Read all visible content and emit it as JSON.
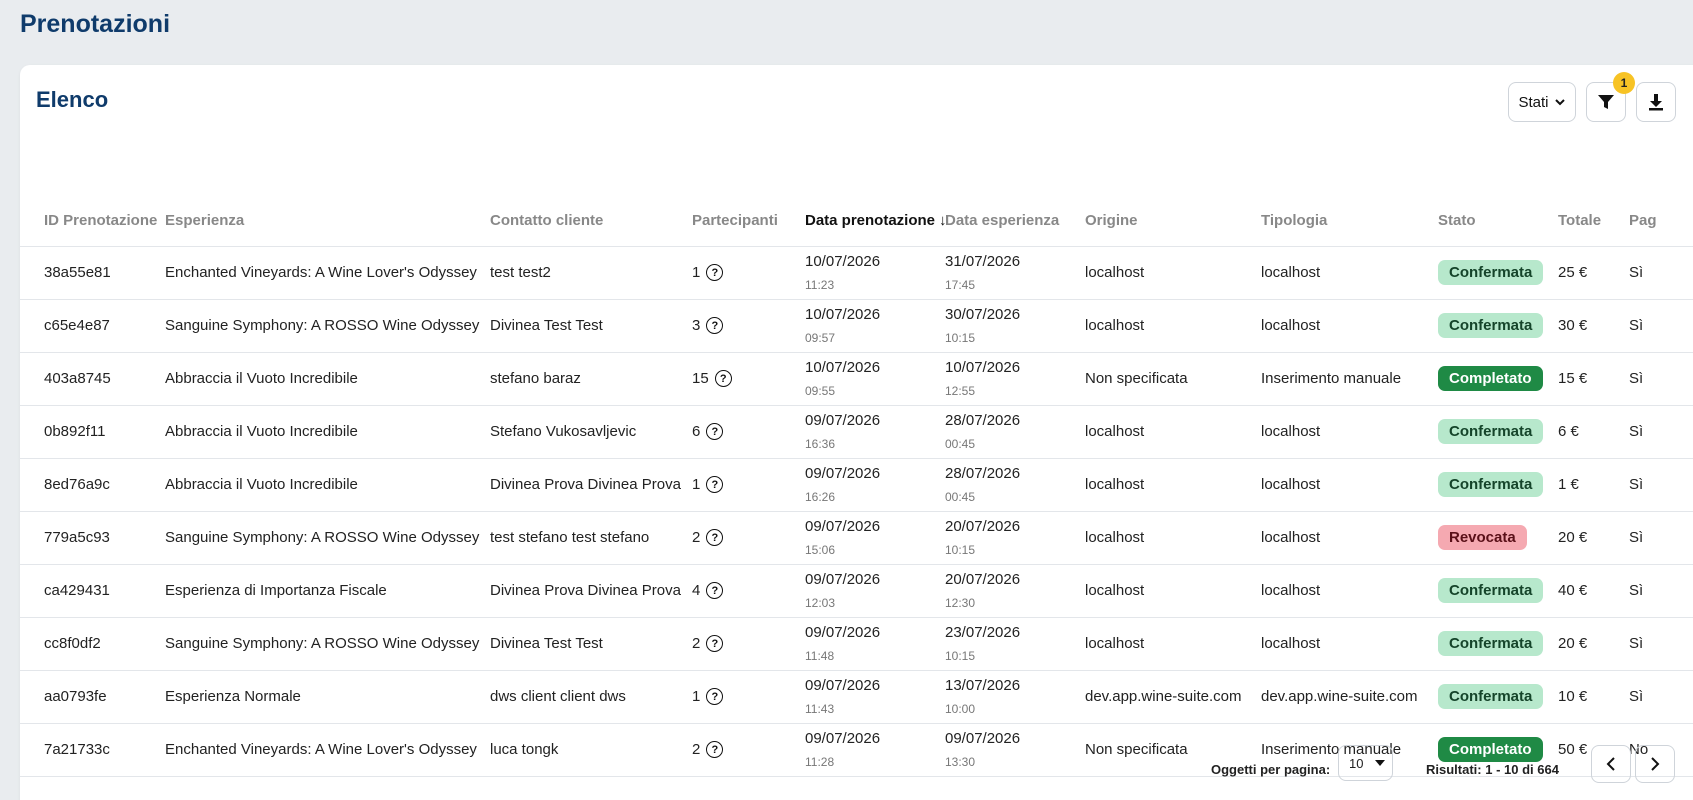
{
  "page_title": "Prenotazioni",
  "card_title": "Elenco",
  "toolbar": {
    "stati_label": "Stati",
    "filter_badge": "1"
  },
  "columns": [
    "ID Prenotazione",
    "Esperienza",
    "Contatto cliente",
    "Partecipanti",
    "Data prenotazione",
    "Data esperienza",
    "Origine",
    "Tipologia",
    "Stato",
    "Totale",
    "Pag"
  ],
  "sort_icon": "↓",
  "rows": [
    {
      "id": "38a55e81",
      "exp": "Enchanted Vineyards: A Wine Lover's Odyssey",
      "contact": "test test2",
      "part": "1",
      "bdate": "10/07/2026",
      "btime": "11:23",
      "edate": "31/07/2026",
      "etime": "17:45",
      "origin": "localhost",
      "type": "localhost",
      "status": "Confermata",
      "tot": "25 €",
      "pag": "Sì"
    },
    {
      "id": "c65e4e87",
      "exp": "Sanguine Symphony: A ROSSO Wine Odyssey",
      "contact": "Divinea Test Test",
      "part": "3",
      "bdate": "10/07/2026",
      "btime": "09:57",
      "edate": "30/07/2026",
      "etime": "10:15",
      "origin": "localhost",
      "type": "localhost",
      "status": "Confermata",
      "tot": "30 €",
      "pag": "Sì"
    },
    {
      "id": "403a8745",
      "exp": "Abbraccia il Vuoto Incredibile",
      "contact": "stefano baraz",
      "part": "15",
      "bdate": "10/07/2026",
      "btime": "09:55",
      "edate": "10/07/2026",
      "etime": "12:55",
      "origin": "Non specificata",
      "type": "Inserimento manuale",
      "status": "Completato",
      "tot": "15 €",
      "pag": "Sì"
    },
    {
      "id": "0b892f11",
      "exp": "Abbraccia il Vuoto Incredibile",
      "contact": "Stefano Vukosavljevic",
      "part": "6",
      "bdate": "09/07/2026",
      "btime": "16:36",
      "edate": "28/07/2026",
      "etime": "00:45",
      "origin": "localhost",
      "type": "localhost",
      "status": "Confermata",
      "tot": "6 €",
      "pag": "Sì"
    },
    {
      "id": "8ed76a9c",
      "exp": "Abbraccia il Vuoto Incredibile",
      "contact": "Divinea Prova Divinea Prova",
      "part": "1",
      "bdate": "09/07/2026",
      "btime": "16:26",
      "edate": "28/07/2026",
      "etime": "00:45",
      "origin": "localhost",
      "type": "localhost",
      "status": "Confermata",
      "tot": "1 €",
      "pag": "Sì"
    },
    {
      "id": "779a5c93",
      "exp": "Sanguine Symphony: A ROSSO Wine Odyssey",
      "contact": "test stefano test stefano",
      "part": "2",
      "bdate": "09/07/2026",
      "btime": "15:06",
      "edate": "20/07/2026",
      "etime": "10:15",
      "origin": "localhost",
      "type": "localhost",
      "status": "Revocata",
      "tot": "20 €",
      "pag": "Sì"
    },
    {
      "id": "ca429431",
      "exp": "Esperienza di Importanza Fiscale",
      "contact": "Divinea Prova Divinea Prova",
      "part": "4",
      "bdate": "09/07/2026",
      "btime": "12:03",
      "edate": "20/07/2026",
      "etime": "12:30",
      "origin": "localhost",
      "type": "localhost",
      "status": "Confermata",
      "tot": "40 €",
      "pag": "Sì"
    },
    {
      "id": "cc8f0df2",
      "exp": "Sanguine Symphony: A ROSSO Wine Odyssey",
      "contact": "Divinea Test Test",
      "part": "2",
      "bdate": "09/07/2026",
      "btime": "11:48",
      "edate": "23/07/2026",
      "etime": "10:15",
      "origin": "localhost",
      "type": "localhost",
      "status": "Confermata",
      "tot": "20 €",
      "pag": "Sì"
    },
    {
      "id": "aa0793fe",
      "exp": "Esperienza Normale",
      "contact": "dws client client dws",
      "part": "1",
      "bdate": "09/07/2026",
      "btime": "11:43",
      "edate": "13/07/2026",
      "etime": "10:00",
      "origin": "dev.app.wine-suite.com",
      "type": "dev.app.wine-suite.com",
      "status": "Confermata",
      "tot": "10 €",
      "pag": "Sì"
    },
    {
      "id": "7a21733c",
      "exp": "Enchanted Vineyards: A Wine Lover's Odyssey",
      "contact": "luca tongk",
      "part": "2",
      "bdate": "09/07/2026",
      "btime": "11:28",
      "edate": "09/07/2026",
      "etime": "13:30",
      "origin": "Non specificata",
      "type": "Inserimento manuale",
      "status": "Completato",
      "tot": "50 €",
      "pag": "No"
    }
  ],
  "status_colors": {
    "Confermata": "#b7e8cc",
    "Completato": "#1f8a45",
    "Revocata": "#f5a9b1"
  },
  "footer": {
    "per_page_label": "Oggetti per pagina:",
    "per_page_value": "10",
    "results": "Risultati: 1 - 10 di 664"
  }
}
